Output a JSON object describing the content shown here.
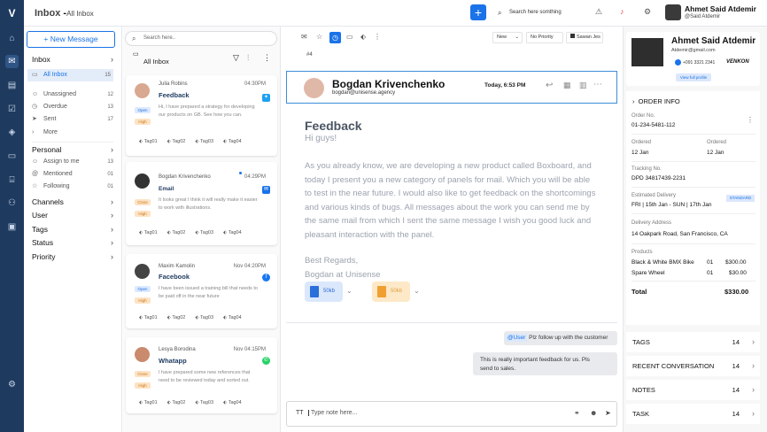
{
  "app": {
    "title": "Inbox",
    "breadcrumb": "All Inbox",
    "logo": "V"
  },
  "topbar": {
    "search_placeholder": "Search here somthing",
    "user_name": "Ahmet Said Atdemir",
    "user_handle": "@Said Atdemir"
  },
  "nav": {
    "new_message": "+ New Message",
    "inbox": "Inbox",
    "all_inbox": "All Inbox",
    "all_inbox_count": "15",
    "items1": [
      {
        "label": "Unassigned",
        "count": "12"
      },
      {
        "label": "Overdue",
        "count": "13"
      },
      {
        "label": "Sent",
        "count": "17"
      },
      {
        "label": "More",
        "count": ""
      }
    ],
    "personal": "Personal",
    "items2": [
      {
        "label": "Assign to me",
        "count": "13"
      },
      {
        "label": "Mentioned",
        "count": "01"
      },
      {
        "label": "Following",
        "count": "01"
      }
    ],
    "channels": "Channels",
    "user": "User",
    "tags": "Tags",
    "status": "Status",
    "priority": "Priority"
  },
  "list": {
    "search_placeholder": "Search here..",
    "heading": "All Inbox",
    "cards": [
      {
        "name": "Julia Robins",
        "time": "04:30PM",
        "subject": "Feedback",
        "text": "Hi, I have prepared a strategy for developing our products on GB. See how you can.",
        "open": "Open",
        "high": "High",
        "tags": [
          "Tag01",
          "Tag02",
          "Tag03",
          "Tag04"
        ]
      },
      {
        "name": "Bogdan Krivenchenko",
        "time": "04:29PM",
        "subject": "Email",
        "text": "It looks great I think it will really make it easier to work with illustrations.",
        "open": "Close",
        "high": "High",
        "tags": [
          "Tag01",
          "Tag02",
          "Tag03",
          "Tag04"
        ]
      },
      {
        "name": "Maxim Kamolin",
        "time": "Nov 04:20PM",
        "subject": "Facebook",
        "text": "I have been issued a training bill that needs to be paid off in the near future",
        "open": "Open",
        "high": "High",
        "tags": [
          "Tag01",
          "Tag02",
          "Tag03",
          "Tag04"
        ]
      },
      {
        "name": "Lesya Borodina",
        "time": "Nov 04:15PM",
        "subject": "Whatapp",
        "text": "I have prepared some new references that need to be reviewed today and sorted out.",
        "open": "Close",
        "high": "High",
        "tags": [
          "Tag01",
          "Tag02",
          "Tag03",
          "Tag04"
        ]
      }
    ]
  },
  "main": {
    "thread_id": "#4",
    "filter1": "New",
    "filter2": "No Priority",
    "filter3": "Sawan Jes",
    "sender_name": "Bogdan Krivenchenko",
    "sender_email": "bogdan@unisense.agency",
    "date": "Today, 6:53 PM",
    "subject": "Feedback",
    "greeting": "Hi guys!",
    "paragraph": "As you already know, we are developing a new product called Boxboard, and today I present you a new category of panels for mail. Which you will be able to test in the near future. I would also like to get feedback on the shortcomings and various kinds of bugs. All messages about the work you can send me by the same mail from which I sent the same message I wish you good luck and pleasant interaction with the panel.",
    "sig1": "Best Regards,",
    "sig2": "Bogdan at Unisense",
    "att1": "50kb",
    "att2": "50kb",
    "mention": "@User",
    "chat1": " Plz follow up with the customer",
    "chat2_l1": "This is really important feedback for us. Pls",
    "chat2_l2": "send to sales.",
    "composer_tt": "TT",
    "composer_placeholder": "Type note here..."
  },
  "right": {
    "name": "Ahmet Said Atdemir",
    "email": "Atdemir@gmail.com",
    "phone": "+091 3321 2341",
    "brand": "VENKON",
    "view_profile": "View full profile",
    "order_info": "ORDER INFO",
    "order_no_label": "Order No.",
    "order_no": "01-234-5481-112",
    "ordered_label": "Ordered",
    "ordered_val": "12 Jan",
    "ordered_label2": "Ordered",
    "ordered_val2": "12 Jan",
    "tracking_label": "Tracking No.",
    "tracking_val": "DPD 34817439-2231",
    "delivery_label": "Estimated Delivery",
    "delivery_val": "FRI  |  15th Jan - SUN  |  17th Jan",
    "standard": "STANDARD",
    "address_label": "Delivery Address",
    "address_val": "14 Oakpark Road, San Francisco, CA",
    "products_label": "Products",
    "p1": "Black & White BMX Bike",
    "p1q": "01",
    "p1p": "$300.00",
    "p2": "Spare Wheel",
    "p2q": "01",
    "p2p": "$30.00",
    "total_label": "Total",
    "total_val": "$330.00",
    "acc": [
      {
        "label": "TAGS",
        "n": "14"
      },
      {
        "label": "RECENT CONVERSATION",
        "n": "14"
      },
      {
        "label": "NOTES",
        "n": "14"
      },
      {
        "label": "TASK",
        "n": "14"
      }
    ]
  }
}
